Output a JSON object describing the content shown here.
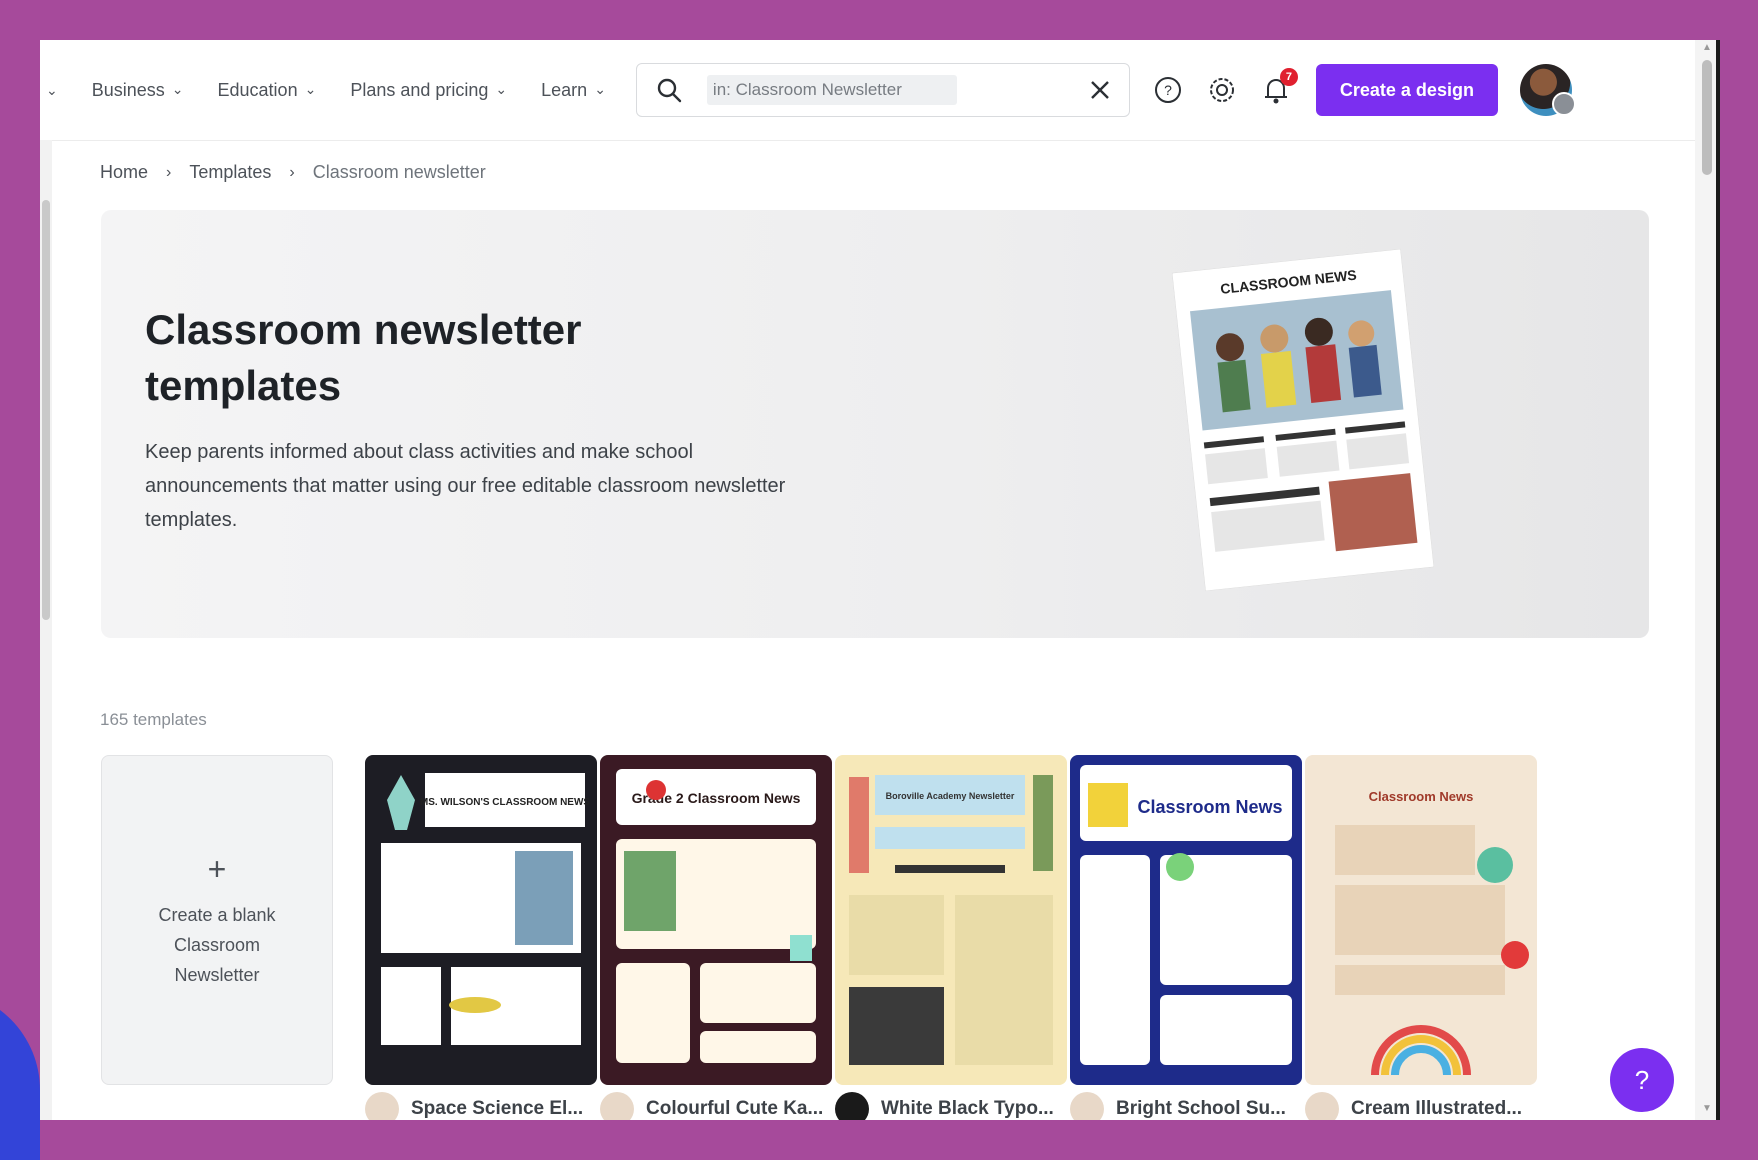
{
  "nav": {
    "items": [
      {
        "label": "Business"
      },
      {
        "label": "Education"
      },
      {
        "label": "Plans and pricing"
      },
      {
        "label": "Learn"
      }
    ],
    "search_value": "in: Classroom Newsletter",
    "notification_count": "7",
    "create_button": "Create a design"
  },
  "breadcrumb": {
    "home": "Home",
    "templates": "Templates",
    "current": "Classroom newsletter"
  },
  "hero": {
    "title": "Classroom newsletter templates",
    "description": "Keep parents informed about class activities and make school announcements that matter using our free editable classroom newsletter templates.",
    "image_title": "CLASSROOM NEWS"
  },
  "results": {
    "count": "165 templates",
    "blank_card": "Create a blank Classroom Newsletter",
    "templates": [
      {
        "title": "Space Science El...",
        "thumb_title": "MS. WILSON'S CLASSROOM NEWS",
        "bg": "#1d1d24"
      },
      {
        "title": "Colourful Cute Ka...",
        "thumb_title": "Grade 2 Classroom News",
        "bg": "#3b1a24"
      },
      {
        "title": "White Black Typo...",
        "thumb_title": "Boroville Academy Newsletter",
        "bg": "#f6e8b8"
      },
      {
        "title": "Bright School Su...",
        "thumb_title": "Classroom News",
        "bg": "#1e2b8a"
      },
      {
        "title": "Cream Illustrated...",
        "thumb_title": "Classroom News",
        "bg": "#f3e6d4"
      }
    ]
  },
  "help": "?"
}
